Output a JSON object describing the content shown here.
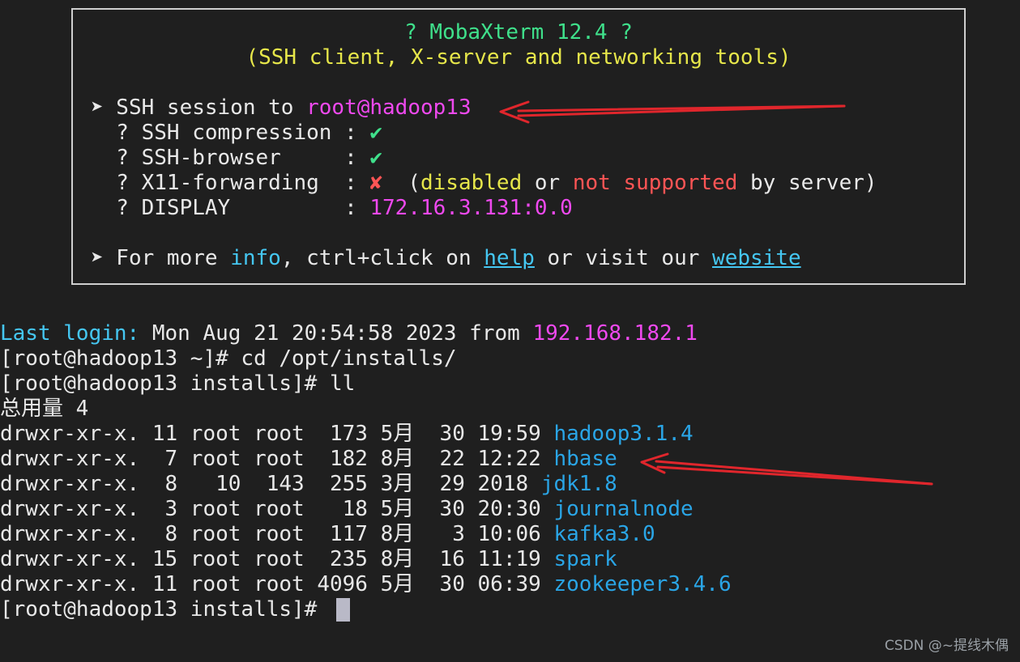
{
  "banner": {
    "title": "? MobaXterm 12.4 ?",
    "subtitle": "(SSH client, X-server and networking tools)",
    "session_prefix": "➤ SSH session to ",
    "session_target": "root@hadoop13",
    "rows": [
      {
        "label": "  ? SSH compression : ",
        "mark": "✔",
        "mark_color": "#3fe08b"
      },
      {
        "label": "  ? SSH-browser     : ",
        "mark": "✔",
        "mark_color": "#3fe08b"
      },
      {
        "label": "  ? X11-forwarding  : ",
        "mark": "✘",
        "mark_color": "#ff5555"
      }
    ],
    "x11_note": {
      "open": "  (",
      "disabled": "disabled",
      "or": " or ",
      "not_supported": "not supported",
      "by_server": " by server)"
    },
    "display_label": "  ? DISPLAY         : ",
    "display_value": "172.16.3.131:0.0",
    "more": {
      "prefix": "➤ For more ",
      "info": "info",
      "mid": ", ctrl+click on ",
      "help": "help",
      "mid2": " or visit our ",
      "website": "website"
    }
  },
  "terminal": {
    "last_login_label": "Last login:",
    "last_login_text": " Mon Aug 21 20:54:58 2023 from ",
    "last_login_ip": "192.168.182.1",
    "cmd1": "[root@hadoop13 ~]# cd /opt/installs/",
    "cmd2": "[root@hadoop13 installs]# ll",
    "total": "总用量 4",
    "listing": [
      {
        "meta": "drwxr-xr-x. 11 root root  173 5月  30 19:59 ",
        "name": "hadoop3.1.4"
      },
      {
        "meta": "drwxr-xr-x.  7 root root  182 8月  22 12:22 ",
        "name": "hbase"
      },
      {
        "meta": "drwxr-xr-x.  8   10  143  255 3月  29 2018 ",
        "name": "jdk1.8"
      },
      {
        "meta": "drwxr-xr-x.  3 root root   18 5月  30 20:30 ",
        "name": "journalnode"
      },
      {
        "meta": "drwxr-xr-x.  8 root root  117 8月   3 10:06 ",
        "name": "kafka3.0"
      },
      {
        "meta": "drwxr-xr-x. 15 root root  235 8月  16 11:19 ",
        "name": "spark"
      },
      {
        "meta": "drwxr-xr-x. 11 root root 4096 5月  30 06:39 ",
        "name": "zookeeper3.4.6"
      }
    ],
    "prompt": "[root@hadoop13 installs]# "
  },
  "watermark": "CSDN @~提线木偶",
  "colors": {
    "background": "#1f1f1f",
    "annotation_arrow": "#e0262c",
    "directory": "#2aa5e6"
  }
}
